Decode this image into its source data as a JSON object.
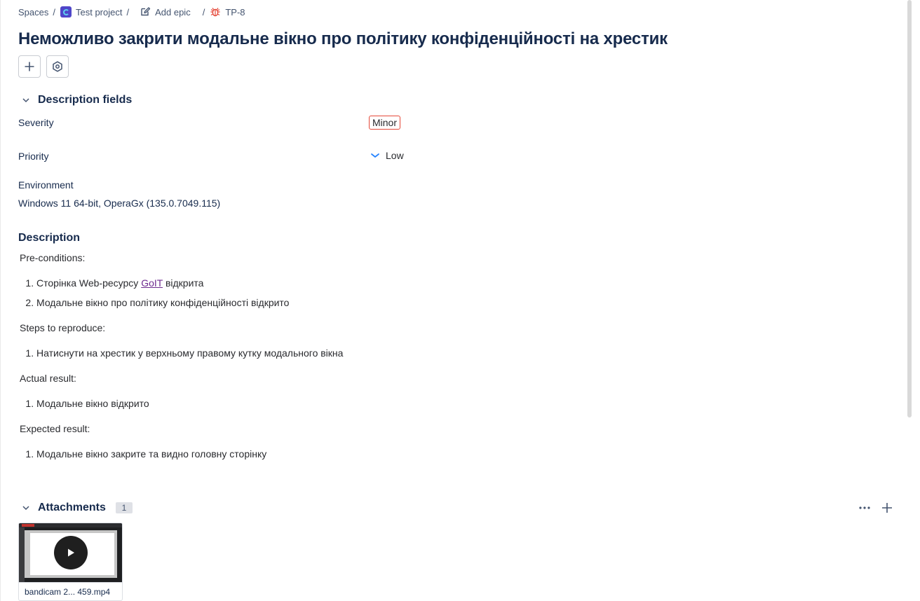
{
  "breadcrumb": {
    "spaces": "Spaces",
    "project": "Test project",
    "add_epic": "Add epic",
    "issue_key": "TP-8"
  },
  "issue": {
    "title": "Неможливо закрити модальне вікно про політику конфіденційності на хрестик"
  },
  "description_fields": {
    "heading": "Description fields",
    "severity_label": "Severity",
    "severity_value": "Minor",
    "priority_label": "Priority",
    "priority_value": "Low",
    "environment_label": "Environment",
    "environment_value": "Windows 11 64-bit, OperaGx (135.0.7049.115)"
  },
  "description": {
    "heading": "Description",
    "preconditions_label": "Pre-conditions:",
    "pre1_before": "Сторінка Web-ресурсу ",
    "pre1_link": "GoIT",
    "pre1_after": " відкрита",
    "pre2": "Модальне вікно про політику конфіденційності відкрито",
    "steps_label": "Steps to reproduce:",
    "step1": "Натиснути на хрестик у верхньому правому кутку модального вікна",
    "actual_label": "Actual result:",
    "actual1": "Модальне вікно відкрито",
    "expected_label": "Expected result:",
    "expected1": "Модальне вікно закрите та видно головну сторінку"
  },
  "attachments": {
    "heading": "Attachments",
    "count": "1",
    "files": [
      {
        "name": "bandicam 2... 459.mp4"
      }
    ]
  },
  "colors": {
    "severity_border": "#e5493a",
    "bug_icon": "#e5493a",
    "link": "#6e2c8f",
    "priority_icon": "#2684ff"
  },
  "icons": {
    "project": "project-avatar-icon",
    "add_epic": "edit-icon",
    "issue_type": "bug-icon",
    "add": "plus-icon",
    "settings": "gear-icon",
    "collapse": "chevron-down-icon",
    "priority": "priority-low-icon",
    "more": "more-icon",
    "play": "play-icon"
  }
}
